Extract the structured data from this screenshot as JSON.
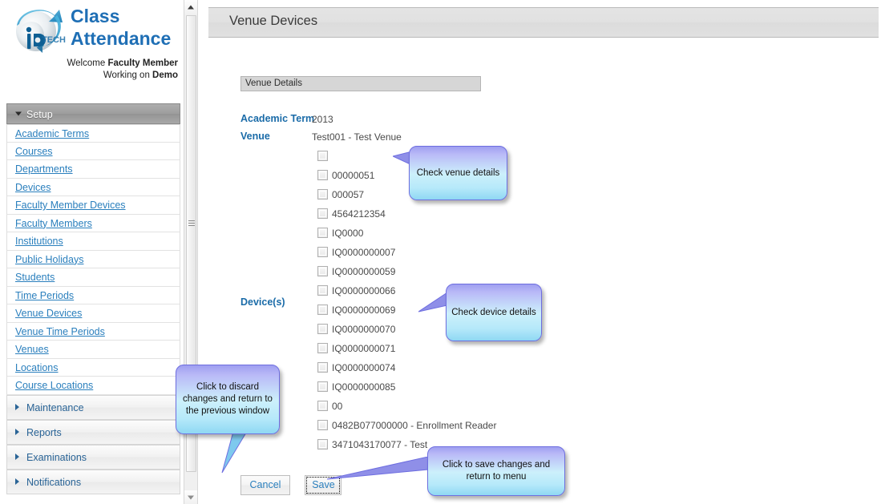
{
  "brand": {
    "logo_icon": "globe-swoosh-logo",
    "title_line1": "Class",
    "title_line2": "Attendance",
    "welcome_prefix": "Welcome ",
    "welcome_role": "Faculty Member",
    "working_prefix": "Working on ",
    "working_target": "Demo",
    "accent_color": "#1f6fb5"
  },
  "sidebar": {
    "sections": [
      {
        "label": "Setup",
        "expanded": true,
        "icon": "chevron-down-icon"
      },
      {
        "label": "Maintenance",
        "expanded": false,
        "icon": "chevron-right-icon"
      },
      {
        "label": "Reports",
        "expanded": false,
        "icon": "chevron-right-icon"
      },
      {
        "label": "Examinations",
        "expanded": false,
        "icon": "chevron-right-icon"
      },
      {
        "label": "Notifications",
        "expanded": false,
        "icon": "chevron-right-icon"
      }
    ],
    "setup_items": [
      "Academic Terms",
      "Courses",
      "Departments",
      "Devices",
      "Faculty Member Devices",
      "Faculty Members",
      "Institutions",
      "Public Holidays",
      "Students",
      "Time Periods",
      "Venue Devices",
      "Venue Time Periods",
      "Venues",
      "Locations",
      "Course Locations"
    ],
    "link_color": "#2a7fbd"
  },
  "scrollbar": {
    "up_arrow": "triangle-up-icon",
    "down_arrow": "triangle-down-icon",
    "grip": "grip-lines-icon"
  },
  "main": {
    "page_title": "Venue Devices",
    "panel_title": "Venue Details",
    "fields": [
      {
        "label": "Academic Term",
        "value": "2013"
      },
      {
        "label": "Venue",
        "value": "Test001 - Test Venue"
      }
    ],
    "devices_label": "Device(s)",
    "devices": [
      {
        "label": "",
        "checked": false
      },
      {
        "label": "00000051",
        "checked": false
      },
      {
        "label": "000057",
        "checked": false
      },
      {
        "label": "4564212354",
        "checked": false
      },
      {
        "label": "IQ0000",
        "checked": false
      },
      {
        "label": "IQ0000000007",
        "checked": false
      },
      {
        "label": "IQ0000000059",
        "checked": false
      },
      {
        "label": "IQ0000000066",
        "checked": false
      },
      {
        "label": "IQ0000000069",
        "checked": false
      },
      {
        "label": "IQ0000000070",
        "checked": false
      },
      {
        "label": "IQ0000000071",
        "checked": false
      },
      {
        "label": "IQ0000000074",
        "checked": false
      },
      {
        "label": "IQ0000000085",
        "checked": false
      },
      {
        "label": "00",
        "checked": false
      },
      {
        "label": "0482B077000000 - Enrollment Reader",
        "checked": false
      },
      {
        "label": "3471043170077 - Test",
        "checked": false
      }
    ],
    "buttons": {
      "cancel": "Cancel",
      "save": "Save"
    }
  },
  "callouts": {
    "venue": "Check venue details",
    "device": "Check device details",
    "cancel": "Click to discard changes and return to the previous window",
    "save": "Click to save changes and return to menu",
    "fill_top": "#9f9ff0",
    "fill_bottom": "#8fd8f3",
    "border": "#6e6ee0"
  }
}
